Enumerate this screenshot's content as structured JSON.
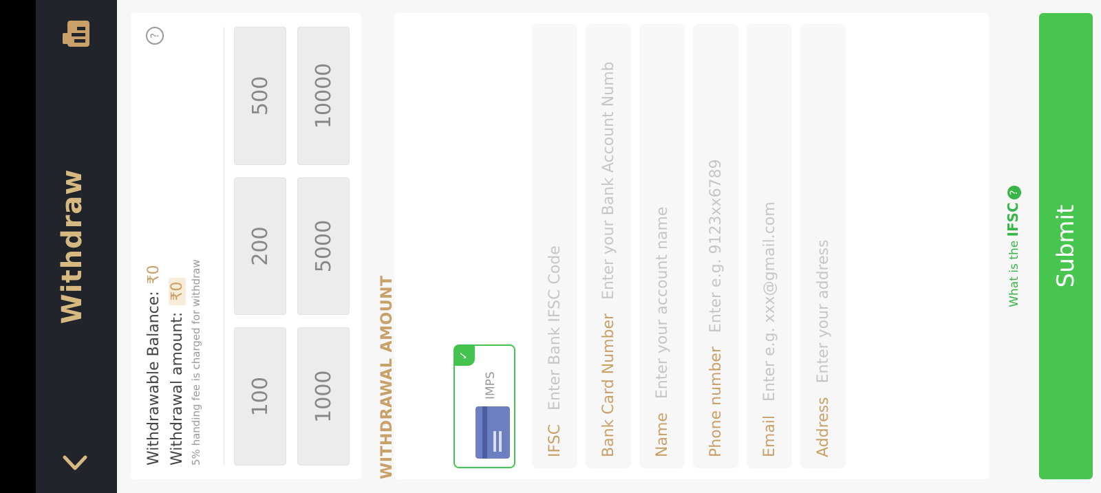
{
  "header": {
    "title": "Withdraw"
  },
  "balance": {
    "withdrawable_label": "Withdrawable Balance:",
    "withdrawable_value": "₹0",
    "amount_label": "Withdrawal amount:",
    "amount_value": "₹0",
    "fee_note": "5% handing fee is charged for withdraw"
  },
  "amount_options": [
    "100",
    "200",
    "500",
    "1000",
    "5000",
    "10000"
  ],
  "section_title": "WITHDRAWAL AMOUNT",
  "method": {
    "label": "IMPS",
    "selected": true,
    "check_glyph": "✓"
  },
  "fields": {
    "ifsc": {
      "label": "IFSC",
      "placeholder": "Enter Bank IFSC Code"
    },
    "bank_card": {
      "label": "Bank Card Number",
      "placeholder": "Enter your Bank Account Numb"
    },
    "name": {
      "label": "Name",
      "placeholder": "Enter your account name"
    },
    "phone": {
      "label": "Phone number",
      "placeholder": "Enter e.g. 9123xx6789"
    },
    "email": {
      "label": "Email",
      "placeholder": "Enter e.g. xxx@gmail.com"
    },
    "address": {
      "label": "Address",
      "placeholder": "Enter your address"
    }
  },
  "ifsc_help": {
    "prefix": "What is the",
    "highlight": "IFSC",
    "icon": "?"
  },
  "help_icon": "?",
  "submit_label": "Submit",
  "colors": {
    "header_bg": "#22242c",
    "gold": "#c9a067",
    "green": "#47c54f"
  }
}
